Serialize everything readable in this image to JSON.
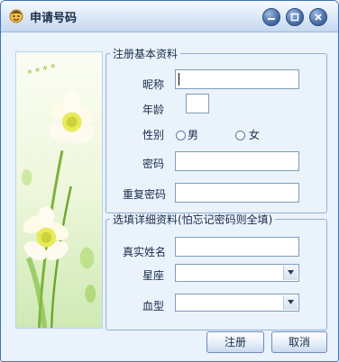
{
  "window": {
    "title": "申请号码"
  },
  "basic": {
    "legend": "注册基本资料",
    "nickname_label": "昵称",
    "nickname_value": "",
    "age_label": "年龄",
    "age_value": "",
    "gender_label": "性别",
    "male_label": "男",
    "female_label": "女",
    "password_label": "密码",
    "password_value": "",
    "confirm_label": "重复密码",
    "confirm_value": ""
  },
  "detail": {
    "legend": "选填详细资料(怕忘记密码则全填)",
    "realname_label": "真实姓名",
    "realname_value": "",
    "zodiac_label": "星座",
    "zodiac_value": "",
    "blood_label": "血型",
    "blood_value": ""
  },
  "buttons": {
    "register": "注册",
    "cancel": "取消"
  },
  "icons": {
    "app": "avatar-face-icon",
    "minimize": "minimize-icon",
    "restore": "restore-icon",
    "close": "close-icon",
    "dropdown": "chevron-down-icon"
  },
  "colors": {
    "window_bg": "#eaf2fb",
    "border": "#3e72b8",
    "title_button": "#4e74ad"
  }
}
